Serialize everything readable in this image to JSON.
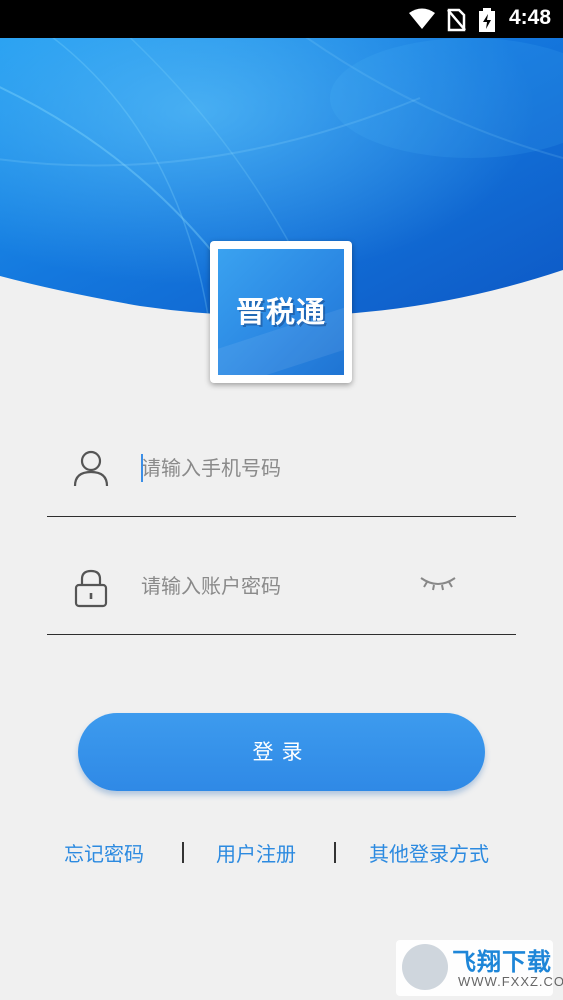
{
  "status_bar": {
    "time": "4:48",
    "icons": [
      "wifi-icon",
      "no-sim-icon",
      "battery-charging-icon"
    ]
  },
  "app": {
    "logo_text": "晋税通",
    "brand_color": "#2a86e2"
  },
  "form": {
    "phone": {
      "placeholder": "请输入手机号码",
      "value": "",
      "icon": "user-icon"
    },
    "password": {
      "placeholder": "请输入账户密码",
      "value": "",
      "icon": "lock-icon",
      "toggle_icon": "eye-closed-icon"
    },
    "login_label": "登录"
  },
  "links": {
    "forgot": "忘记密码",
    "register": "用户注册",
    "other": "其他登录方式"
  },
  "watermark": {
    "main": "飞翔下载",
    "sub": "WWW.FXXZ.COM"
  }
}
